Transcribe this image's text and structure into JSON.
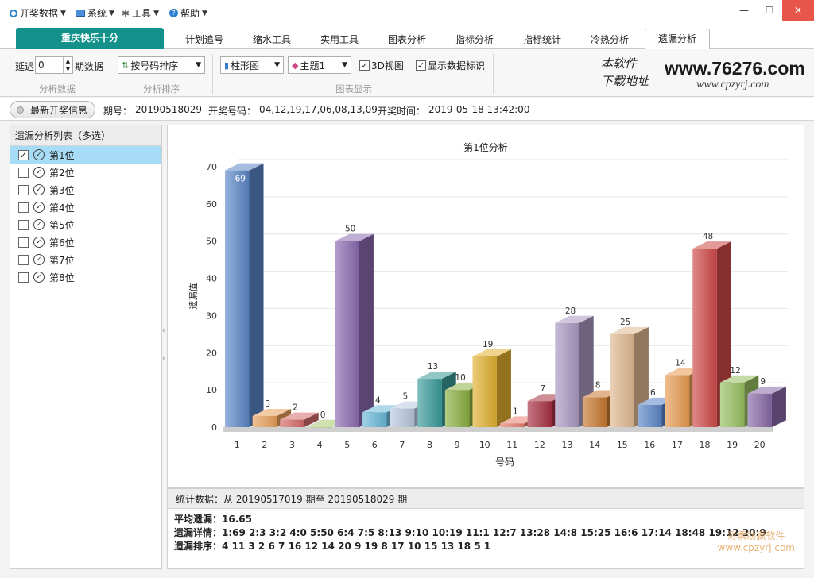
{
  "menu": [
    {
      "label": "开奖数据",
      "icon": "circle-icon"
    },
    {
      "label": "系统",
      "icon": "monitor-icon"
    },
    {
      "label": "工具",
      "icon": "tools-icon"
    },
    {
      "label": "帮助",
      "icon": "help-icon"
    }
  ],
  "window": {
    "minimize": "—",
    "maximize": "☐",
    "close": "✕"
  },
  "main_tab": "重庆快乐十分",
  "tabs": [
    {
      "label": "计划追号"
    },
    {
      "label": "缩水工具"
    },
    {
      "label": "实用工具"
    },
    {
      "label": "图表分析"
    },
    {
      "label": "指标分析"
    },
    {
      "label": "指标统计"
    },
    {
      "label": "冷热分析"
    },
    {
      "label": "遗漏分析",
      "active": true
    }
  ],
  "toolbar": {
    "delay_label": "延迟",
    "delay_value": "0",
    "periods_label": "期数据",
    "group1": "分析数据",
    "sort_value": "按号码排序",
    "group2": "分析排序",
    "chart_type": "柱形图",
    "theme": "主题1",
    "view3d_label": "3D视图",
    "view3d_checked": true,
    "show_labels_label": "显示数据标识",
    "show_labels_checked": true,
    "group3": "图表显示"
  },
  "logo": {
    "line1": "本软件",
    "line2": "下载地址",
    "site1": "www.76276.com",
    "site2": "www.cpzyrj.com"
  },
  "infobar": {
    "button": "最新开奖信息",
    "period_label": "期号：",
    "period": "20190518029",
    "numbers_label": "开奖号码：",
    "numbers": "04,12,19,17,06,08,13,09",
    "time_label": "开奖时间：",
    "time": "2019-05-18 13:42:00"
  },
  "leftpanel": {
    "header": "遗漏分析列表（多选）",
    "items": [
      {
        "label": "第1位",
        "checked": true
      },
      {
        "label": "第2位",
        "checked": false
      },
      {
        "label": "第3位",
        "checked": false
      },
      {
        "label": "第4位",
        "checked": false
      },
      {
        "label": "第5位",
        "checked": false
      },
      {
        "label": "第6位",
        "checked": false
      },
      {
        "label": "第7位",
        "checked": false
      },
      {
        "label": "第8位",
        "checked": false
      }
    ]
  },
  "splitter": {
    "left": "‹",
    "right": "›"
  },
  "chart_data": {
    "type": "bar",
    "title": "第1位分析",
    "xlabel": "号码",
    "ylabel": "遗漏值",
    "categories": [
      "1",
      "2",
      "3",
      "4",
      "5",
      "6",
      "7",
      "8",
      "9",
      "10",
      "11",
      "12",
      "13",
      "14",
      "15",
      "16",
      "17",
      "18",
      "19",
      "20"
    ],
    "values": [
      69,
      3,
      2,
      0,
      50,
      4,
      5,
      13,
      10,
      19,
      1,
      7,
      28,
      8,
      25,
      6,
      14,
      48,
      12,
      9
    ],
    "ylim": [
      0,
      70
    ],
    "yticks": [
      "0",
      "10",
      "20",
      "30",
      "40",
      "50",
      "60",
      "70"
    ],
    "grid": true,
    "view_3d": true,
    "colors": [
      "#5a86c6",
      "#e8a05a",
      "#d56a6a",
      "#a8c86a",
      "#8a6ab0",
      "#6ab8d8",
      "#b8c8e0",
      "#3a9a9a",
      "#8ab040",
      "#e0b030",
      "#e88070",
      "#a83040",
      "#a898c0",
      "#c87830",
      "#e0b890",
      "#5a86c6",
      "#e89a50",
      "#d04848",
      "#98c060",
      "#8868a8"
    ]
  },
  "stats": {
    "header": "统计数据：从 20190517019 期至 20190518029 期",
    "avg": "平均遗漏：16.65",
    "detail": "遗漏详情：1:69   2:3   3:2   4:0   5:50   6:4   7:5   8:13   9:10   10:19   11:1   12:7   13:28   14:8   15:25   16:6   17:14   18:48   19:12   20:9",
    "order": "遗漏排序：4   11   3   2   6   7   16   12   14   20   9   19   8   17   10   15   13   18   5   1"
  },
  "watermark": {
    "line1": "彩票助赢软件",
    "line2": "www.cpzyrj.com"
  }
}
